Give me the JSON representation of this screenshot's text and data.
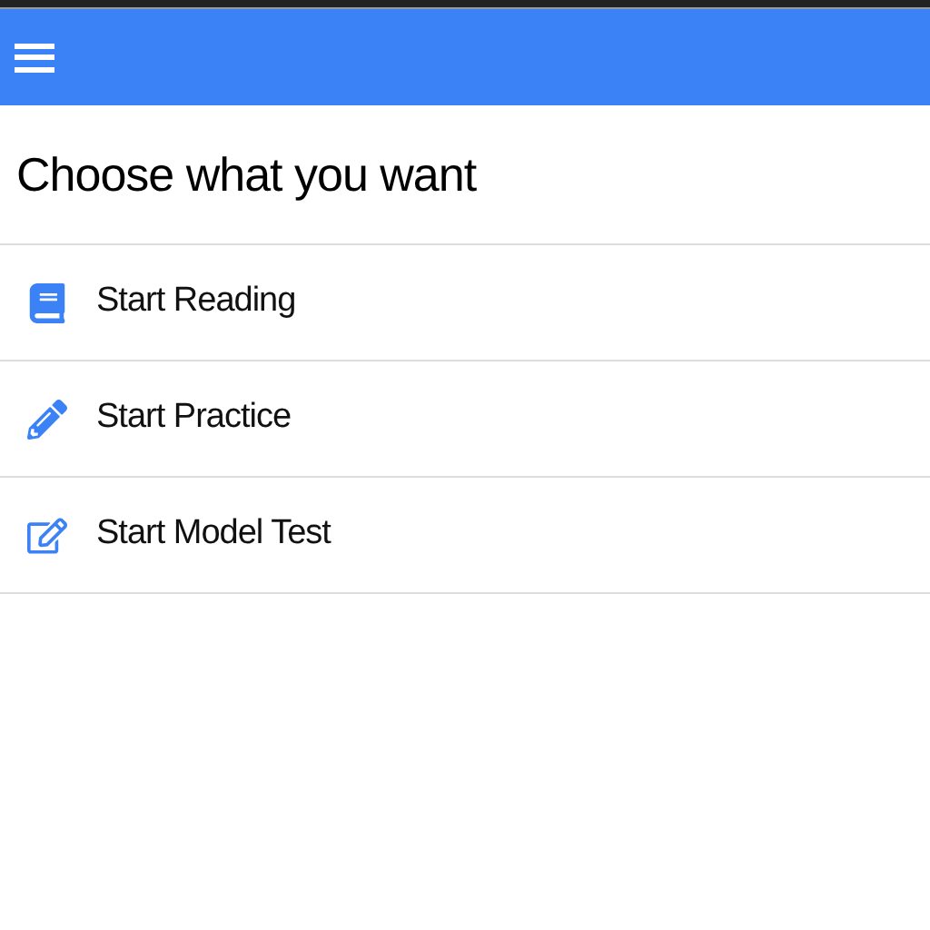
{
  "heading": "Choose what you want",
  "menu": [
    {
      "kind": "book",
      "label": "Start Reading"
    },
    {
      "kind": "pencil",
      "label": "Start Practice"
    },
    {
      "kind": "edit",
      "label": "Start Model Test"
    }
  ]
}
